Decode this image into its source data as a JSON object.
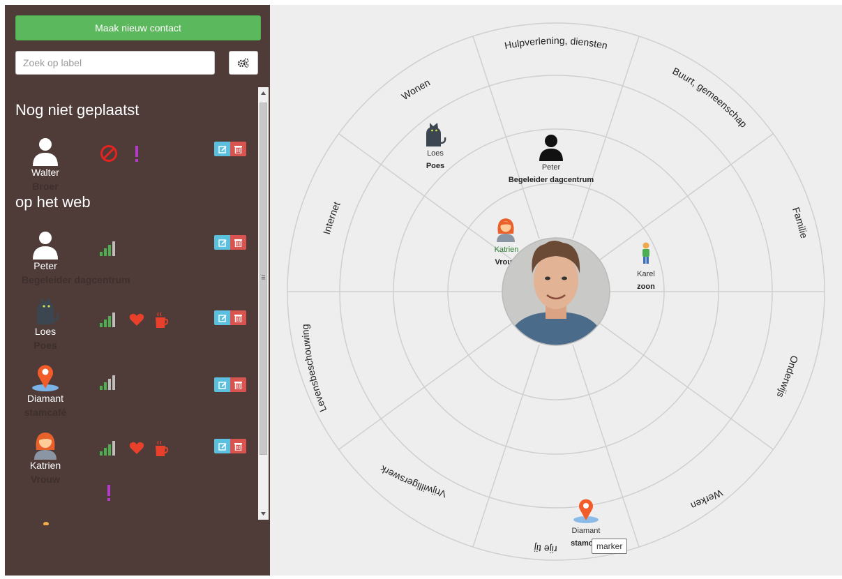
{
  "sidebar": {
    "new_contact_label": "Maak nieuw contact",
    "search_placeholder": "Zoek op label",
    "settings_icon": "cogs-icon",
    "section_unplaced": "Nog niet geplaatst",
    "section_web": "op het web",
    "entries": [
      {
        "name": "Walter",
        "role": "Broer",
        "icon": "person-icon",
        "indicators": [
          "blocked-icon",
          "exclamation-icon"
        ]
      },
      {
        "name": "Peter",
        "role": "Begeleider dagcentrum",
        "icon": "person-icon",
        "signal_level": 3,
        "indicators": [
          "signal-icon"
        ]
      },
      {
        "name": "Loes",
        "role": "Poes",
        "icon": "cat-icon",
        "signal_level": 3,
        "indicators": [
          "signal-icon",
          "heart-icon",
          "coffee-icon"
        ]
      },
      {
        "name": "Diamant",
        "role": "stamcafé",
        "icon": "map-marker-icon",
        "signal_level": 2,
        "indicators": [
          "signal-icon"
        ]
      },
      {
        "name": "Katrien",
        "role": "Vrouw",
        "icon": "woman-icon",
        "signal_level": 3,
        "indicators": [
          "signal-icon",
          "heart-icon",
          "coffee-icon",
          "exclamation-icon"
        ]
      }
    ]
  },
  "colors": {
    "sidebar_bg": "#4f3c39",
    "new_button": "#5cb85c",
    "edit_button": "#5bc0de",
    "delete_button": "#d9534f",
    "signal_active": "#4caf50",
    "signal_inactive": "#bdbdbd",
    "heart": "#e8402a",
    "exclamation": "#b23cc7",
    "map_marker": "#f25b2a"
  },
  "network": {
    "sectors": [
      "Hulpverlening, diensten",
      "Buurt, gemeenschap",
      "Familie",
      "Onderwijs",
      "Werken",
      "Vrije tijd",
      "Vrijwilligerswerk",
      "Levensbeschouwing",
      "Internet",
      "Wonen"
    ],
    "contacts": [
      {
        "name": "Loes",
        "role": "Poes",
        "icon": "cat-icon"
      },
      {
        "name": "Peter",
        "role": "Begeleider dagcentrum",
        "icon": "person-icon"
      },
      {
        "name": "Katrien",
        "role": "Vrouw",
        "icon": "woman-icon"
      },
      {
        "name": "Karel",
        "role": "zoon",
        "icon": "child-icon"
      },
      {
        "name": "Diamant",
        "role": "stamc",
        "icon": "map-marker-icon"
      }
    ],
    "center_icon": "profile-photo"
  },
  "tooltip": "marker"
}
